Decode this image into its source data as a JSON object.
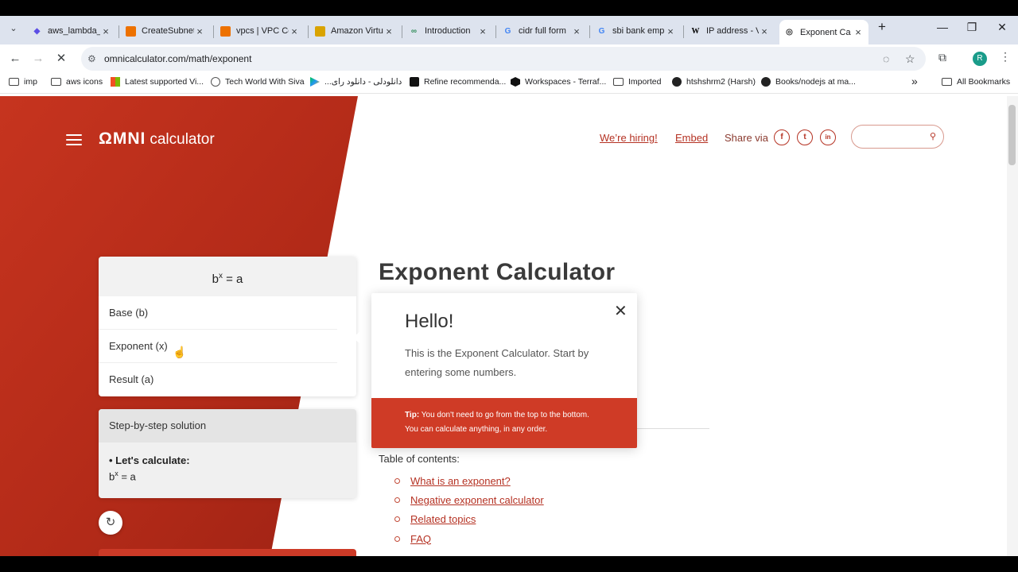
{
  "browser": {
    "tabs": [
      {
        "title": "aws_lambda_",
        "icon": "terraform-icon",
        "color": "#5c4ee5"
      },
      {
        "title": "CreateSubnet",
        "icon": "aws-hex-icon",
        "color": "#ed7100"
      },
      {
        "title": "vpcs | VPC Co",
        "icon": "aws-hex-icon",
        "color": "#ed7100"
      },
      {
        "title": "Amazon Virtu",
        "icon": "aws-box-icon",
        "color": "#d9a300"
      },
      {
        "title": "Introduction",
        "icon": "link-icon",
        "color": "#2e8b57"
      },
      {
        "title": "cidr full form",
        "icon": "google-icon",
        "color": "#4285f4"
      },
      {
        "title": "sbi bank emp",
        "icon": "google-icon",
        "color": "#4285f4"
      },
      {
        "title": "IP address - V",
        "icon": "wikipedia-icon",
        "color": "#000000"
      },
      {
        "title": "Exponent Ca",
        "icon": "omni-icon",
        "color": "#333333",
        "active": true
      }
    ],
    "new_tab": "+",
    "url": "omnicalculator.com/math/exponent",
    "profile_initial": "R",
    "bookmarks": [
      {
        "label": "imp",
        "type": "folder"
      },
      {
        "label": "aws icons",
        "type": "folder"
      },
      {
        "label": "Latest supported Vi...",
        "type": "microsoft"
      },
      {
        "label": "Tech World With Siva",
        "type": "globe"
      },
      {
        "label": "...دانلودلی - دانلود رای",
        "type": "play"
      },
      {
        "label": "Refine recommenda...",
        "type": "medium"
      },
      {
        "label": "Workspaces - Terraf...",
        "type": "hashicorp"
      },
      {
        "label": "Imported",
        "type": "folder"
      },
      {
        "label": "htshshrm2 (Harsh)",
        "type": "github"
      },
      {
        "label": "Books/nodejs at ma...",
        "type": "github"
      }
    ],
    "overflow": "»",
    "all_bookmarks": "All Bookmarks"
  },
  "header": {
    "logo_omni": "ΩMNI",
    "logo_calc": "calculator",
    "hiring": "We’re hiring!",
    "embed": "Embed",
    "share_via": "Share via",
    "social": [
      "f",
      "t",
      "in"
    ]
  },
  "calculator": {
    "formula_base": "b",
    "formula_exp": "x",
    "formula_rest": " = a",
    "fields": [
      "Base (b)",
      "Exponent (x)",
      "Result (a)"
    ],
    "steps_title": "Step-by-step solution",
    "steps_bold": "• Let's calculate:",
    "steps_formula_base": "b",
    "steps_formula_exp": "x",
    "steps_formula_rest": " = a"
  },
  "main": {
    "title": "Exponent Calculator",
    "toc_label": "Table of contents:",
    "toc": [
      "What is an exponent?",
      "Negative exponent calculator",
      "Related topics",
      "FAQ"
    ]
  },
  "popup": {
    "title": "Hello!",
    "text": "This is the Exponent Calculator. Start by entering some numbers.",
    "tip_label": "Tip:",
    "tip_text": " You don't need to go from the top to the bottom. You can calculate anything, in any order."
  },
  "colors": {
    "brand_red": "#cc3a27",
    "link_red": "#b53223"
  }
}
